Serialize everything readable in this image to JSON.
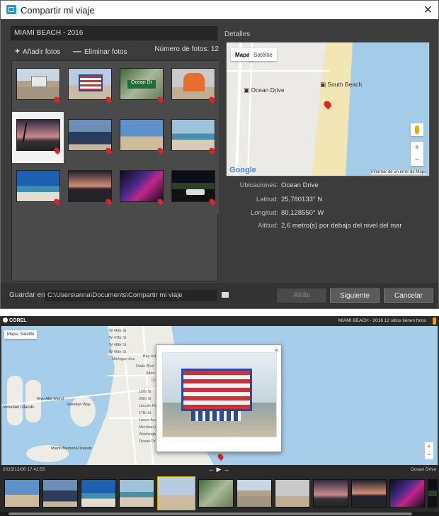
{
  "window": {
    "title": "Compartir mi viaje"
  },
  "trip": {
    "name": "MIAMI BEACH - 2016",
    "add": "Añadir fotos",
    "remove": "Eliminar fotos",
    "count": "Número de fotos: 12",
    "details": "Detalles"
  },
  "map": {
    "tab_map": "Mapa",
    "tab_sat": "Satélite",
    "label1": "Ocean Drive",
    "label2": "South Beach",
    "google": "Google",
    "report": "Informar de un error de Maps",
    "zoom_in": "+",
    "zoom_out": "−"
  },
  "details": [
    {
      "k": "Ubicaciones:",
      "v": "Ocean Drive"
    },
    {
      "k": "Latitud:",
      "v": "25,780133° N"
    },
    {
      "k": "Longitud:",
      "v": "80,128550° W"
    },
    {
      "k": "Altitud:",
      "v": "2,6 metro(s) por debajo del nivel del mar"
    }
  ],
  "bottom": {
    "save_label": "Guardar en:",
    "path": "C:\\Users\\anna\\Documents\\Compartir mi viaje",
    "back": "Atrás",
    "next": "Siguiente",
    "cancel": "Cancelar"
  },
  "viewer": {
    "brand": "COREL",
    "header": "MIAMI BEACH - 2016   12 sitios tienen fotos",
    "date": "2015/12/06 17:42:55",
    "location": "Ocean Drive",
    "close": "×",
    "map_tabs": [
      "Mapa",
      "Satélite"
    ],
    "places": [
      "Venetian Islands",
      "Rivo Alto Island",
      "Venetian Way",
      "Miami Memorial Islands",
      "Bay Rd",
      "Alton Rd",
      "Lincoln Rd",
      "17th St",
      "20th St",
      "15th St",
      "Lenox Ave",
      "Meridian Ave",
      "Washington Ave",
      "Ocean Dr",
      "W 46th St",
      "W 47th St",
      "W 48th St",
      "W 45th St",
      "Michigan Ave",
      "Dade Blvd",
      "Collins Ave"
    ]
  },
  "colors": {
    "accent": "#1e9bd7",
    "pin": "#d8242a",
    "dark": "#3c3c3c"
  }
}
